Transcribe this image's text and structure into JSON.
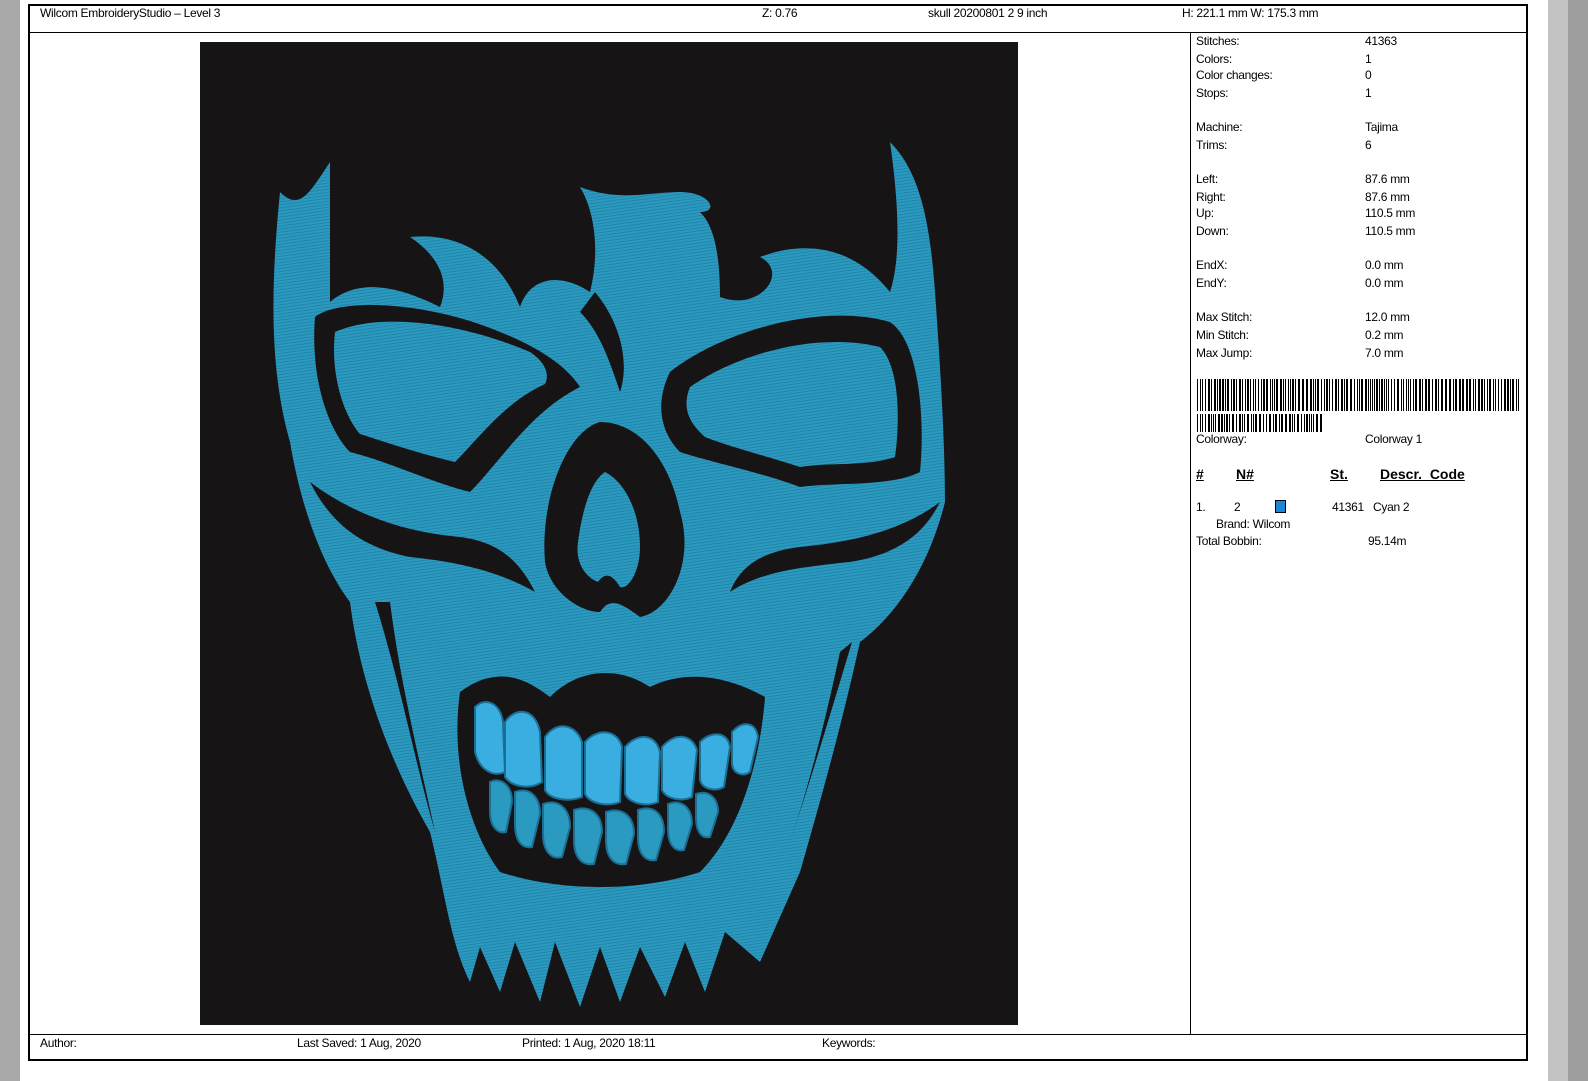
{
  "header": {
    "app": "Wilcom EmbroideryStudio – Level 3",
    "zoom": "Z: 0.76",
    "file": "skull 20200801 2 9 inch",
    "size": "H: 221.1 mm   W: 175.3 mm"
  },
  "stats": {
    "stitches_label": "Stitches:",
    "stitches": "41363",
    "colors_label": "Colors:",
    "colors": "1",
    "color_changes_label": "Color changes:",
    "color_changes": "0",
    "stops_label": "Stops:",
    "stops": "1",
    "machine_label": "Machine:",
    "machine": "Tajima",
    "trims_label": "Trims:",
    "trims": "6",
    "left_label": "Left:",
    "left": "87.6 mm",
    "right_label": "Right:",
    "right": "87.6 mm",
    "up_label": "Up:",
    "up": "110.5 mm",
    "down_label": "Down:",
    "down": "110.5 mm",
    "endx_label": "EndX:",
    "endx": "0.0 mm",
    "endy_label": "EndY:",
    "endy": "0.0 mm",
    "max_stitch_label": "Max Stitch:",
    "max_stitch": "12.0 mm",
    "min_stitch_label": "Min Stitch:",
    "min_stitch": "0.2 mm",
    "max_jump_label": "Max Jump:",
    "max_jump": "7.0 mm",
    "colorway_label": "Colorway:",
    "colorway": "Colorway 1"
  },
  "color_table": {
    "headers": {
      "index": "#",
      "needle": "N#",
      "stitches": "St.",
      "descr": "Descr._Code"
    },
    "rows": [
      {
        "index": "1.",
        "needle": "2",
        "swatch": "#1a86d6",
        "stitches": "41361",
        "descr": "Cyan 2",
        "brand": "Brand: Wilcom"
      }
    ],
    "total_bobbin_label": "Total Bobbin:",
    "total_bobbin": "95.14m"
  },
  "footer": {
    "author": "Author:",
    "last_saved": "Last Saved:  1 Aug, 2020",
    "printed": "Printed:  1 Aug, 2020 18:11",
    "keywords": "Keywords:"
  },
  "design": {
    "background": "#161414",
    "thread_color": "#2b9ac0",
    "teeth_color": "#3aaee0"
  }
}
